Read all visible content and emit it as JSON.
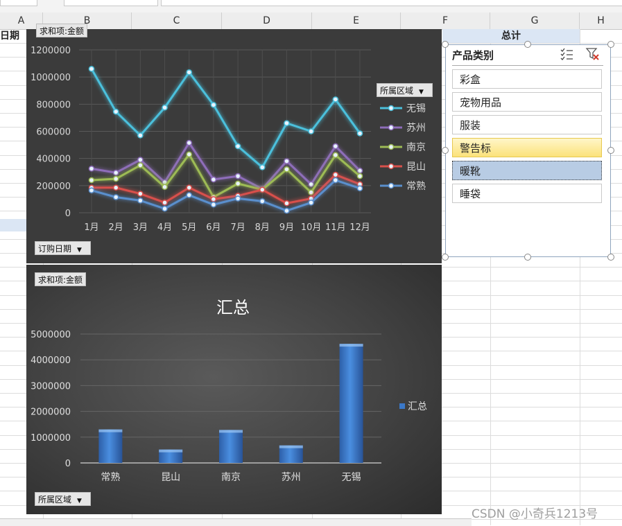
{
  "sheet": {
    "columns": [
      "A",
      "B",
      "C",
      "D",
      "E",
      "F",
      "G",
      "H"
    ],
    "cell_a": "日期",
    "total_header": "总计"
  },
  "chart1": {
    "field_value_btn": "求和项:金额",
    "field_axis_btn": "订购日期",
    "legend_btn": "所属区域"
  },
  "chart2": {
    "field_value_btn": "求和项:金额",
    "field_axis_btn": "所属区域",
    "legend_label": "汇总"
  },
  "chart_data": [
    {
      "type": "line",
      "categories": [
        "1月",
        "2月",
        "3月",
        "4月",
        "5月",
        "6月",
        "7月",
        "8月",
        "9月",
        "10月",
        "11月",
        "12月"
      ],
      "ylim": [
        0,
        1200000
      ],
      "yticks": [
        0,
        200000,
        400000,
        600000,
        800000,
        1000000,
        1200000
      ],
      "grid": true,
      "legend_position": "right",
      "series": [
        {
          "name": "无锡",
          "color": "#4bc0dc",
          "values": [
            1060000,
            745000,
            570000,
            775000,
            1035000,
            795000,
            490000,
            335000,
            660000,
            600000,
            835000,
            585000
          ]
        },
        {
          "name": "苏州",
          "color": "#8e6dba",
          "values": [
            325000,
            295000,
            390000,
            225000,
            515000,
            245000,
            270000,
            175000,
            380000,
            210000,
            490000,
            310000
          ]
        },
        {
          "name": "南京",
          "color": "#9dbb55",
          "values": [
            240000,
            250000,
            350000,
            190000,
            430000,
            115000,
            215000,
            170000,
            320000,
            150000,
            425000,
            270000
          ]
        },
        {
          "name": "昆山",
          "color": "#d9504b",
          "values": [
            185000,
            185000,
            140000,
            75000,
            185000,
            100000,
            125000,
            170000,
            70000,
            105000,
            280000,
            210000
          ]
        },
        {
          "name": "常熟",
          "color": "#5a8fcd",
          "values": [
            165000,
            115000,
            90000,
            30000,
            130000,
            60000,
            105000,
            85000,
            15000,
            75000,
            240000,
            180000
          ]
        }
      ]
    },
    {
      "type": "bar",
      "title": "汇总",
      "categories": [
        "常熟",
        "昆山",
        "南京",
        "苏州",
        "无锡"
      ],
      "ylim": [
        0,
        5000000
      ],
      "yticks": [
        0,
        1000000,
        2000000,
        3000000,
        4000000,
        5000000
      ],
      "grid": true,
      "legend_position": "right",
      "series": [
        {
          "name": "汇总",
          "color": "#3a78c8",
          "values": [
            1300000,
            520000,
            1280000,
            680000,
            4620000
          ]
        }
      ]
    }
  ],
  "slicer": {
    "title": "产品类别",
    "icons": [
      "multi-select-icon",
      "clear-filter-icon"
    ],
    "items": [
      "彩盒",
      "宠物用品",
      "服装",
      "警告标",
      "暖靴",
      "睡袋"
    ]
  },
  "watermark": "CSDN @小奇兵1213号"
}
